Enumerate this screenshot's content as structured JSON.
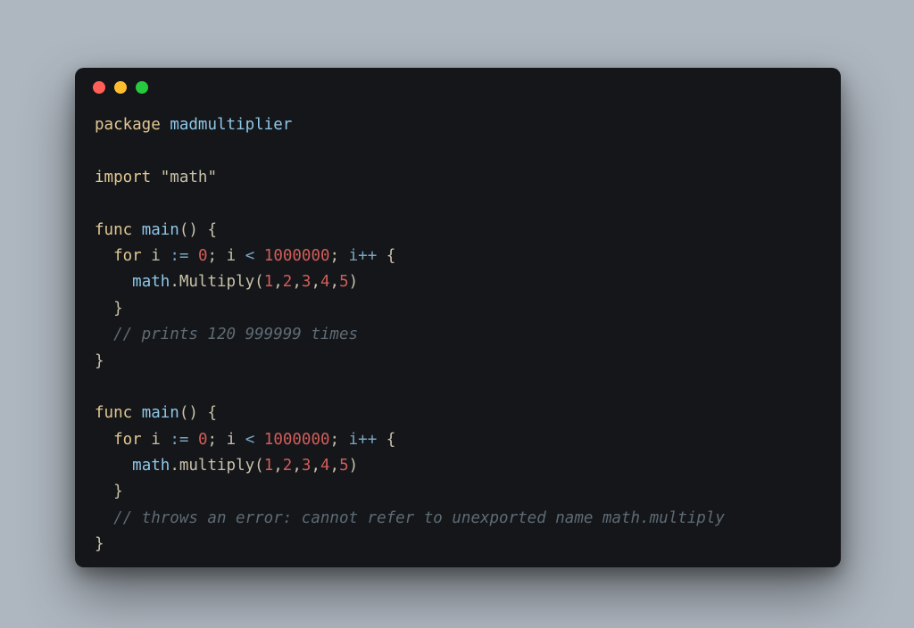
{
  "tokens": {
    "kw_package": "package",
    "pkg_name": "madmultiplier",
    "kw_import": "import",
    "import_path": "\"math\"",
    "kw_func": "func",
    "fn_main": "main",
    "kw_for": "for",
    "id_i": "i",
    "op_decl": ":=",
    "num_zero": "0",
    "op_lt": "<",
    "num_million": "1000000",
    "op_inc": "i++",
    "mod_math": "math",
    "call_Multiply": "Multiply",
    "call_multiply": "multiply",
    "args": {
      "n1": "1",
      "n2": "2",
      "n3": "3",
      "n4": "4",
      "n5": "5"
    },
    "comment1": "// prints 120 999999 times",
    "comment2": "// throws an error: cannot refer to unexported name math.multiply"
  }
}
